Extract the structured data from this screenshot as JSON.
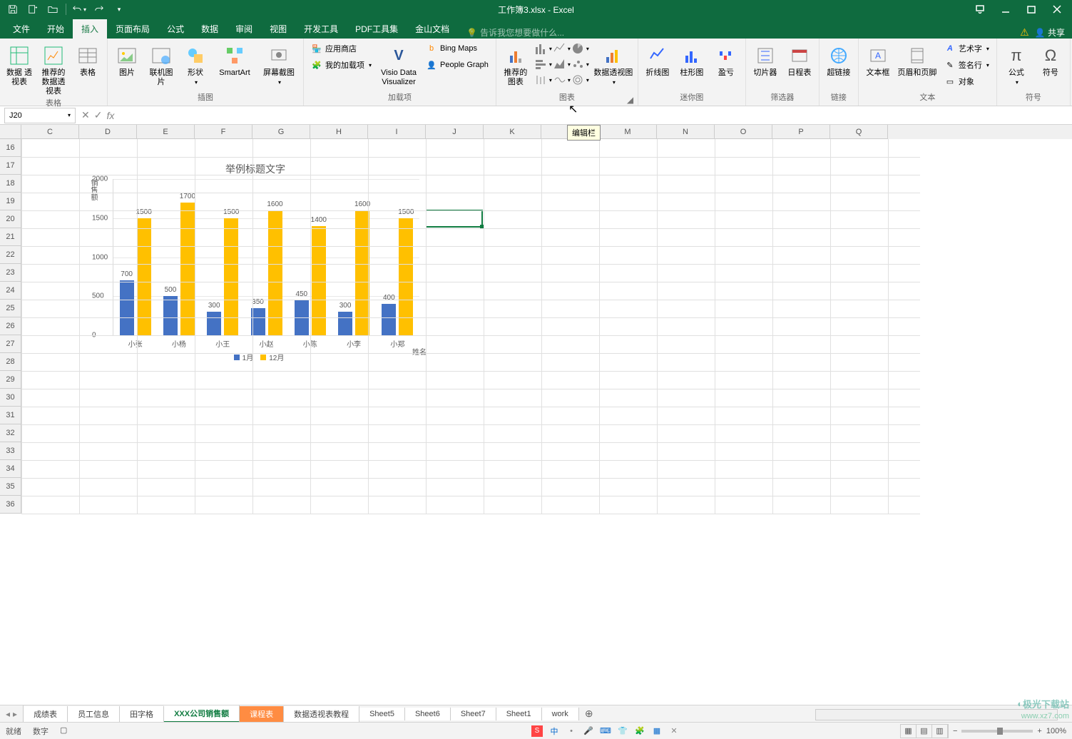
{
  "app": {
    "title": "工作簿3.xlsx - Excel"
  },
  "qat": {
    "save": "保存",
    "new": "新建",
    "open": "打开",
    "undo": "撤销",
    "redo": "恢复"
  },
  "tabs": {
    "file": "文件",
    "home": "开始",
    "insert": "插入",
    "layout": "页面布局",
    "formulas": "公式",
    "data": "数据",
    "review": "审阅",
    "view": "视图",
    "dev": "开发工具",
    "pdf": "PDF工具集",
    "wps": "金山文档",
    "tellme_placeholder": "告诉我您想要做什么...",
    "share": "共享"
  },
  "ribbon": {
    "tables": {
      "label": "表格",
      "pivot": "数据\n透视表",
      "recpivot": "推荐的\n数据透视表",
      "table": "表格"
    },
    "illus": {
      "label": "插图",
      "pic": "图片",
      "online": "联机图片",
      "shapes": "形状",
      "smartart": "SmartArt",
      "screenshot": "屏幕截图"
    },
    "addins": {
      "label": "加载项",
      "store": "应用商店",
      "myaddins": "我的加载项",
      "visio": "Visio Data\nVisualizer",
      "bing": "Bing Maps",
      "people": "People Graph"
    },
    "charts": {
      "label": "图表",
      "recchart": "推荐的\n图表",
      "pivotchart": "数据透视图"
    },
    "spark": {
      "label": "迷你图",
      "line": "折线图",
      "column": "柱形图",
      "winloss": "盈亏"
    },
    "filters": {
      "label": "筛选器",
      "slicer": "切片器",
      "timeline": "日程表"
    },
    "links": {
      "label": "链接",
      "link": "超链接"
    },
    "text": {
      "label": "文本",
      "textbox": "文本框",
      "headerfooter": "页眉和页脚",
      "wordart": "艺术字",
      "sigline": "签名行",
      "object": "对象"
    },
    "symbols": {
      "label": "符号",
      "equation": "公式",
      "symbol": "符号"
    }
  },
  "formula_bar": {
    "name_box": "J20",
    "tip": "编辑栏"
  },
  "columns": [
    "C",
    "D",
    "E",
    "F",
    "G",
    "H",
    "I",
    "J",
    "K",
    "L",
    "M",
    "N",
    "O",
    "P",
    "Q"
  ],
  "rows": [
    16,
    17,
    18,
    19,
    20,
    21,
    22,
    23,
    24,
    25,
    26,
    27,
    28,
    29,
    30,
    31,
    32,
    33,
    34,
    35,
    36
  ],
  "active_cell": {
    "col_index": 7,
    "row_index": 4
  },
  "chart_data": {
    "type": "bar",
    "title": "举例标题文字",
    "ylabel": "销售额",
    "xlabel": "姓名",
    "ylim": [
      0,
      2000
    ],
    "yticks": [
      0,
      500,
      1000,
      1500,
      2000
    ],
    "categories": [
      "小张",
      "小杨",
      "小王",
      "小赵",
      "小陈",
      "小李",
      "小郑"
    ],
    "series": [
      {
        "name": "1月",
        "color": "#4472c4",
        "values": [
          700,
          500,
          300,
          350,
          450,
          300,
          400
        ]
      },
      {
        "name": "12月",
        "color": "#ffc000",
        "values": [
          1500,
          1700,
          1500,
          1600,
          1400,
          1600,
          1500
        ]
      }
    ]
  },
  "sheets": {
    "list": [
      "成绩表",
      "员工信息",
      "田字格",
      "XXX公司销售额",
      "课程表",
      "数据透视表教程",
      "Sheet5",
      "Sheet6",
      "Sheet7",
      "Sheet1",
      "work"
    ],
    "active": "XXX公司销售额",
    "orange": "课程表"
  },
  "status": {
    "ready": "就绪",
    "mode": "数字",
    "zoom": "100%",
    "add": "+"
  },
  "watermark": {
    "url": "www.xz7.com",
    "name": "极光下载站"
  }
}
